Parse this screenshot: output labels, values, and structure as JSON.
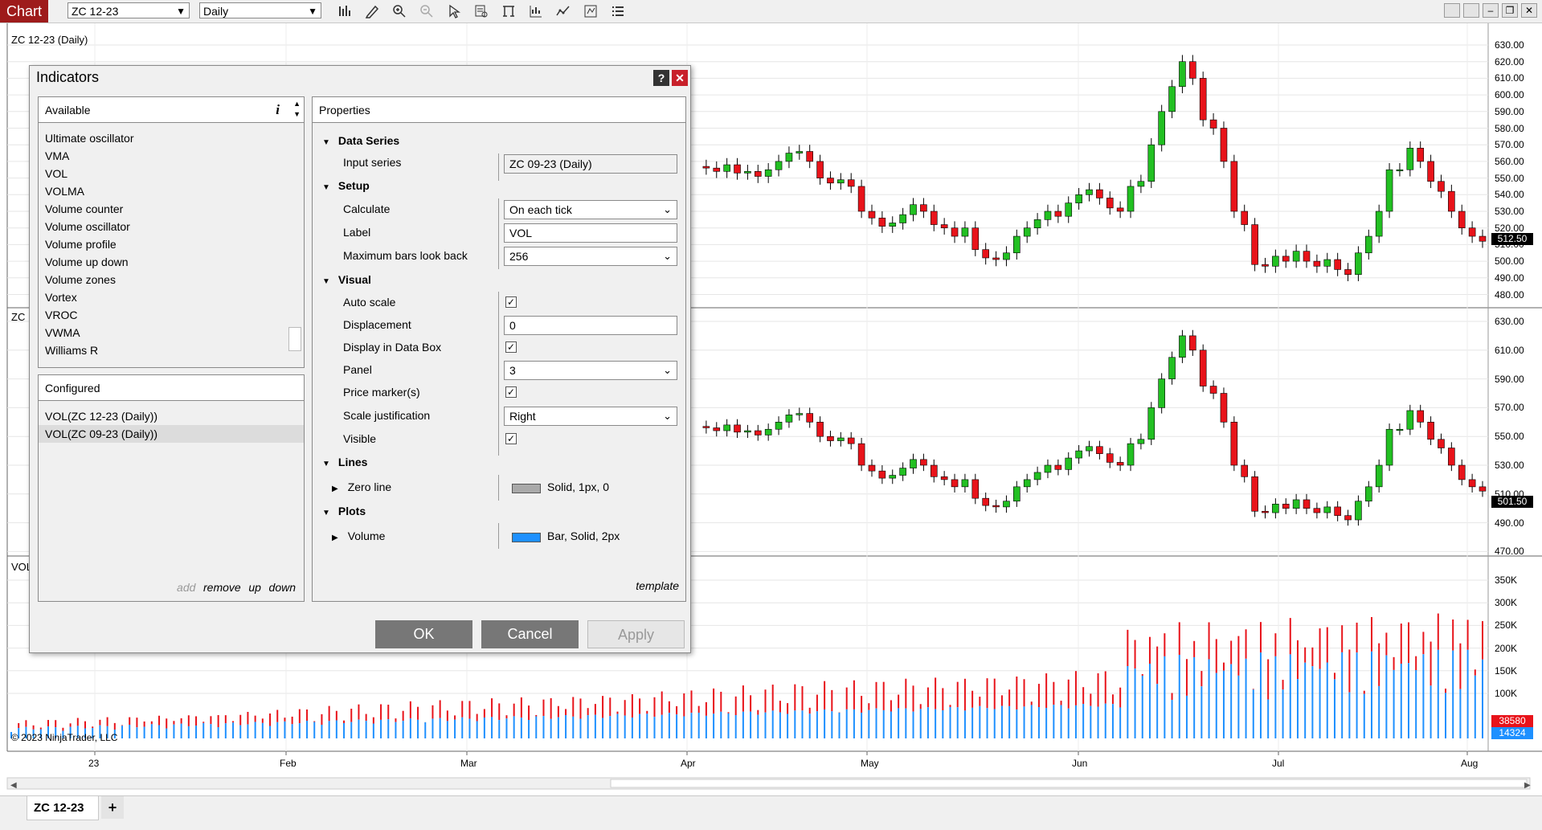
{
  "toolbar": {
    "chart_label": "Chart",
    "instrument": "ZC 12-23",
    "interval": "Daily"
  },
  "colors": {
    "up_candle": "#22c022",
    "down_candle": "#e8131a",
    "volume_up": "#1e90ff",
    "volume_down": "#e8131a",
    "chart_label_bg": "#9e1b1b"
  },
  "chart": {
    "panel1_title": "ZC 12-23 (Daily)",
    "panel2_title": "ZC",
    "panel3_title": "VOL",
    "copyright": "© 2023 NinjaTrader, LLC",
    "panel1_axis": [
      "630.00",
      "620.00",
      "610.00",
      "600.00",
      "590.00",
      "580.00",
      "570.00",
      "560.00",
      "550.00",
      "540.00",
      "530.00",
      "520.00",
      "510.00",
      "500.00",
      "490.00",
      "480.00"
    ],
    "panel2_axis": [
      "630.00",
      "610.00",
      "590.00",
      "570.00",
      "550.00",
      "530.00",
      "510.00",
      "490.00",
      "470.00"
    ],
    "panel3_axis": [
      "350K",
      "300K",
      "250K",
      "200K",
      "150K",
      "100K"
    ],
    "price_tag_1": "512.50",
    "price_tag_2": "501.50",
    "vol_tag_down": "38580",
    "vol_tag_up": "14324",
    "x_axis": [
      "23",
      "Feb",
      "Mar",
      "Apr",
      "May",
      "Jun",
      "Jul",
      "Aug"
    ]
  },
  "tabs": {
    "active": "ZC 12-23",
    "add": "+"
  },
  "dialog": {
    "title": "Indicators",
    "help": "?",
    "close": "✕",
    "available": {
      "header": "Available",
      "info": "i",
      "items": [
        "Ultimate oscillator",
        "VMA",
        "VOL",
        "VOLMA",
        "Volume counter",
        "Volume oscillator",
        "Volume profile",
        "Volume up down",
        "Volume zones",
        "Vortex",
        "VROC",
        "VWMA",
        "Williams R"
      ]
    },
    "configured": {
      "header": "Configured",
      "items": [
        "VOL(ZC 12-23 (Daily))",
        "VOL(ZC 09-23 (Daily))"
      ],
      "actions": {
        "add": "add",
        "remove": "remove",
        "up": "up",
        "down": "down"
      }
    },
    "properties": {
      "header": "Properties",
      "sections": {
        "data_series": "Data Series",
        "setup": "Setup",
        "visual": "Visual",
        "lines": "Lines",
        "plots": "Plots"
      },
      "input_series": {
        "label": "Input series",
        "value": "ZC 09-23 (Daily)"
      },
      "calculate": {
        "label": "Calculate",
        "value": "On each tick"
      },
      "label": {
        "label": "Label",
        "value": "VOL"
      },
      "max_bars": {
        "label": "Maximum bars look back",
        "value": "256"
      },
      "auto_scale": {
        "label": "Auto scale"
      },
      "displacement": {
        "label": "Displacement",
        "value": "0"
      },
      "display_data_box": {
        "label": "Display in Data Box"
      },
      "panel": {
        "label": "Panel",
        "value": "3"
      },
      "price_markers": {
        "label": "Price marker(s)"
      },
      "scale_justification": {
        "label": "Scale justification",
        "value": "Right"
      },
      "visible": {
        "label": "Visible"
      },
      "zero_line": {
        "label": "Zero line",
        "value": "Solid, 1px, 0",
        "color": "#a9a9a9"
      },
      "volume": {
        "label": "Volume",
        "value": "Bar, Solid, 2px",
        "color": "#1e90ff"
      },
      "template": "template"
    },
    "buttons": {
      "ok": "OK",
      "cancel": "Cancel",
      "apply": "Apply"
    }
  }
}
